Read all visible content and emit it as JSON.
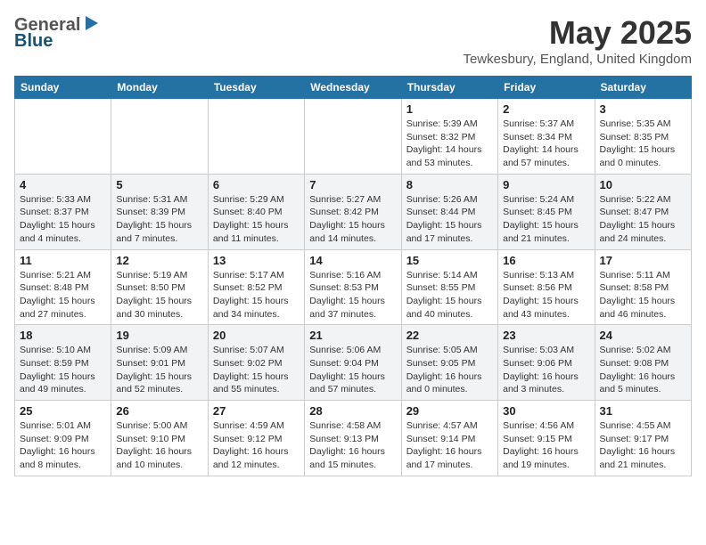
{
  "header": {
    "logo_general": "General",
    "logo_blue": "Blue",
    "title": "May 2025",
    "location": "Tewkesbury, England, United Kingdom"
  },
  "weekdays": [
    "Sunday",
    "Monday",
    "Tuesday",
    "Wednesday",
    "Thursday",
    "Friday",
    "Saturday"
  ],
  "weeks": [
    [
      {
        "day": "",
        "info": ""
      },
      {
        "day": "",
        "info": ""
      },
      {
        "day": "",
        "info": ""
      },
      {
        "day": "",
        "info": ""
      },
      {
        "day": "1",
        "info": "Sunrise: 5:39 AM\nSunset: 8:32 PM\nDaylight: 14 hours\nand 53 minutes."
      },
      {
        "day": "2",
        "info": "Sunrise: 5:37 AM\nSunset: 8:34 PM\nDaylight: 14 hours\nand 57 minutes."
      },
      {
        "day": "3",
        "info": "Sunrise: 5:35 AM\nSunset: 8:35 PM\nDaylight: 15 hours\nand 0 minutes."
      }
    ],
    [
      {
        "day": "4",
        "info": "Sunrise: 5:33 AM\nSunset: 8:37 PM\nDaylight: 15 hours\nand 4 minutes."
      },
      {
        "day": "5",
        "info": "Sunrise: 5:31 AM\nSunset: 8:39 PM\nDaylight: 15 hours\nand 7 minutes."
      },
      {
        "day": "6",
        "info": "Sunrise: 5:29 AM\nSunset: 8:40 PM\nDaylight: 15 hours\nand 11 minutes."
      },
      {
        "day": "7",
        "info": "Sunrise: 5:27 AM\nSunset: 8:42 PM\nDaylight: 15 hours\nand 14 minutes."
      },
      {
        "day": "8",
        "info": "Sunrise: 5:26 AM\nSunset: 8:44 PM\nDaylight: 15 hours\nand 17 minutes."
      },
      {
        "day": "9",
        "info": "Sunrise: 5:24 AM\nSunset: 8:45 PM\nDaylight: 15 hours\nand 21 minutes."
      },
      {
        "day": "10",
        "info": "Sunrise: 5:22 AM\nSunset: 8:47 PM\nDaylight: 15 hours\nand 24 minutes."
      }
    ],
    [
      {
        "day": "11",
        "info": "Sunrise: 5:21 AM\nSunset: 8:48 PM\nDaylight: 15 hours\nand 27 minutes."
      },
      {
        "day": "12",
        "info": "Sunrise: 5:19 AM\nSunset: 8:50 PM\nDaylight: 15 hours\nand 30 minutes."
      },
      {
        "day": "13",
        "info": "Sunrise: 5:17 AM\nSunset: 8:52 PM\nDaylight: 15 hours\nand 34 minutes."
      },
      {
        "day": "14",
        "info": "Sunrise: 5:16 AM\nSunset: 8:53 PM\nDaylight: 15 hours\nand 37 minutes."
      },
      {
        "day": "15",
        "info": "Sunrise: 5:14 AM\nSunset: 8:55 PM\nDaylight: 15 hours\nand 40 minutes."
      },
      {
        "day": "16",
        "info": "Sunrise: 5:13 AM\nSunset: 8:56 PM\nDaylight: 15 hours\nand 43 minutes."
      },
      {
        "day": "17",
        "info": "Sunrise: 5:11 AM\nSunset: 8:58 PM\nDaylight: 15 hours\nand 46 minutes."
      }
    ],
    [
      {
        "day": "18",
        "info": "Sunrise: 5:10 AM\nSunset: 8:59 PM\nDaylight: 15 hours\nand 49 minutes."
      },
      {
        "day": "19",
        "info": "Sunrise: 5:09 AM\nSunset: 9:01 PM\nDaylight: 15 hours\nand 52 minutes."
      },
      {
        "day": "20",
        "info": "Sunrise: 5:07 AM\nSunset: 9:02 PM\nDaylight: 15 hours\nand 55 minutes."
      },
      {
        "day": "21",
        "info": "Sunrise: 5:06 AM\nSunset: 9:04 PM\nDaylight: 15 hours\nand 57 minutes."
      },
      {
        "day": "22",
        "info": "Sunrise: 5:05 AM\nSunset: 9:05 PM\nDaylight: 16 hours\nand 0 minutes."
      },
      {
        "day": "23",
        "info": "Sunrise: 5:03 AM\nSunset: 9:06 PM\nDaylight: 16 hours\nand 3 minutes."
      },
      {
        "day": "24",
        "info": "Sunrise: 5:02 AM\nSunset: 9:08 PM\nDaylight: 16 hours\nand 5 minutes."
      }
    ],
    [
      {
        "day": "25",
        "info": "Sunrise: 5:01 AM\nSunset: 9:09 PM\nDaylight: 16 hours\nand 8 minutes."
      },
      {
        "day": "26",
        "info": "Sunrise: 5:00 AM\nSunset: 9:10 PM\nDaylight: 16 hours\nand 10 minutes."
      },
      {
        "day": "27",
        "info": "Sunrise: 4:59 AM\nSunset: 9:12 PM\nDaylight: 16 hours\nand 12 minutes."
      },
      {
        "day": "28",
        "info": "Sunrise: 4:58 AM\nSunset: 9:13 PM\nDaylight: 16 hours\nand 15 minutes."
      },
      {
        "day": "29",
        "info": "Sunrise: 4:57 AM\nSunset: 9:14 PM\nDaylight: 16 hours\nand 17 minutes."
      },
      {
        "day": "30",
        "info": "Sunrise: 4:56 AM\nSunset: 9:15 PM\nDaylight: 16 hours\nand 19 minutes."
      },
      {
        "day": "31",
        "info": "Sunrise: 4:55 AM\nSunset: 9:17 PM\nDaylight: 16 hours\nand 21 minutes."
      }
    ]
  ]
}
